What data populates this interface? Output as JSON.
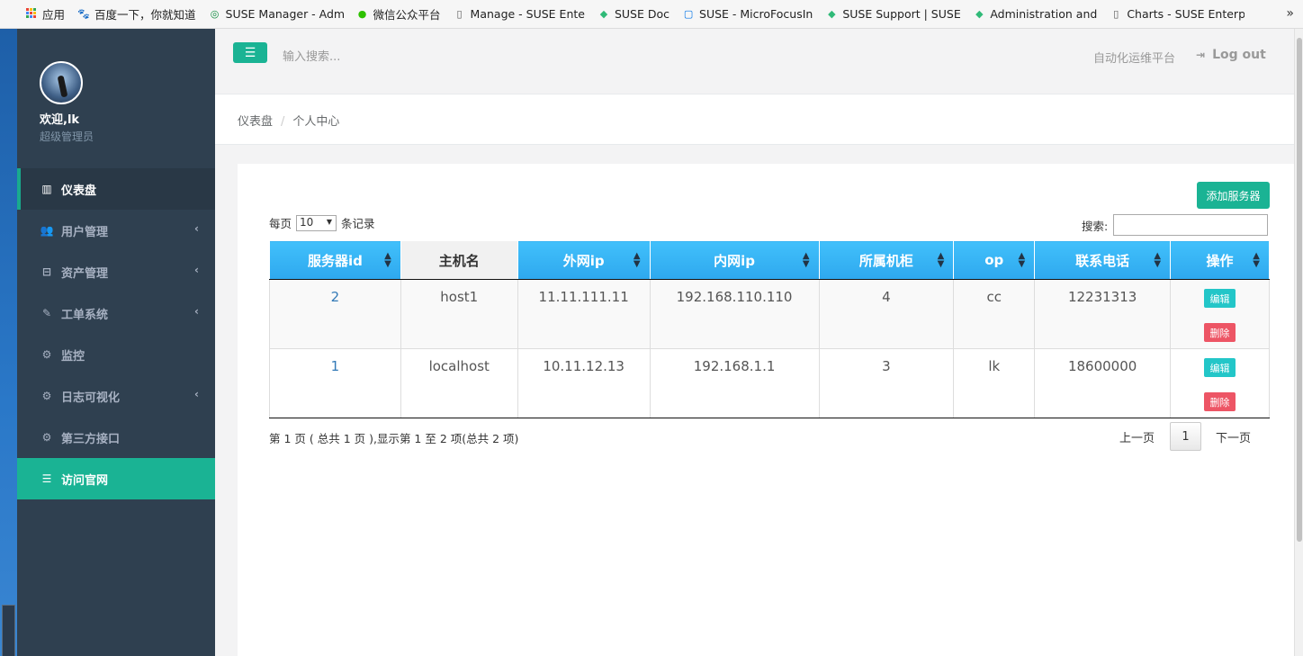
{
  "bookmarks": {
    "items": [
      {
        "label": "应用",
        "icon": "apps-grid-icon"
      },
      {
        "label": "百度一下，你就知道",
        "icon": "baidu-paw-icon"
      },
      {
        "label": "SUSE Manager - Adm",
        "icon": "suse-spiral-icon"
      },
      {
        "label": "微信公众平台",
        "icon": "wechat-icon"
      },
      {
        "label": "Manage - SUSE Ente",
        "icon": "page-icon"
      },
      {
        "label": "SUSE Doc",
        "icon": "suse-chameleon-icon"
      },
      {
        "label": "SUSE - MicroFocusIn",
        "icon": "microfocus-icon"
      },
      {
        "label": "SUSE Support | SUSE",
        "icon": "suse-chameleon-icon"
      },
      {
        "label": "Administration and",
        "icon": "suse-chameleon-icon"
      },
      {
        "label": "Charts - SUSE Enterp",
        "icon": "page-icon"
      }
    ],
    "more": "»"
  },
  "sidebar": {
    "welcome": "欢迎,lk",
    "role": "超级管理员",
    "items": [
      {
        "label": "仪表盘",
        "icon": "map-icon",
        "state": "active",
        "has_arrow": false
      },
      {
        "label": "用户管理",
        "icon": "users-icon",
        "state": "",
        "has_arrow": true
      },
      {
        "label": "资产管理",
        "icon": "inbox-icon",
        "state": "",
        "has_arrow": true
      },
      {
        "label": "工单系统",
        "icon": "edit-icon",
        "state": "",
        "has_arrow": true
      },
      {
        "label": "监控",
        "icon": "cogs-icon",
        "state": "",
        "has_arrow": false
      },
      {
        "label": "日志可视化",
        "icon": "cogs-icon",
        "state": "",
        "has_arrow": true
      },
      {
        "label": "第三方接口",
        "icon": "cogs-icon",
        "state": "",
        "has_arrow": false
      },
      {
        "label": "访问官网",
        "icon": "database-icon",
        "state": "highlight",
        "has_arrow": false
      }
    ]
  },
  "header": {
    "search_placeholder": "输入搜索...",
    "platform": "自动化运维平台",
    "logout": "Log out"
  },
  "breadcrumb": {
    "home": "仪表盘",
    "separator": "/",
    "current": "个人中心"
  },
  "table_controls": {
    "add_button": "添加服务器",
    "length_prefix": "每页",
    "length_value": "10",
    "length_suffix": "条记录",
    "search_label": "搜索:"
  },
  "table": {
    "columns": [
      {
        "label": "服务器id",
        "sortable": true
      },
      {
        "label": "主机名",
        "sortable": false
      },
      {
        "label": "外网ip",
        "sortable": true
      },
      {
        "label": "内网ip",
        "sortable": true
      },
      {
        "label": "所属机柜",
        "sortable": true
      },
      {
        "label": "op",
        "sortable": true
      },
      {
        "label": "联系电话",
        "sortable": true
      },
      {
        "label": "操作",
        "sortable": true
      }
    ],
    "rows": [
      {
        "id": "2",
        "hostname": "host1",
        "public_ip": "11.11.111.11",
        "private_ip": "192.168.110.110",
        "cabinet": "4",
        "op": "cc",
        "phone": "12231313"
      },
      {
        "id": "1",
        "hostname": "localhost",
        "public_ip": "10.11.12.13",
        "private_ip": "192.168.1.1",
        "cabinet": "3",
        "op": "lk",
        "phone": "18600000"
      }
    ],
    "edit_label": "编辑",
    "delete_label": "删除"
  },
  "footer": {
    "info": "第 1 页 ( 总共 1 页 ),显示第 1 至 2 项(总共 2 项)",
    "prev": "上一页",
    "current_page": "1",
    "next": "下一页"
  },
  "colors": {
    "accent": "#1ab394",
    "sidebar_bg": "#2f4050",
    "table_header": "#3ab6f3",
    "edit": "#23c6c8",
    "delete": "#ed5565"
  }
}
